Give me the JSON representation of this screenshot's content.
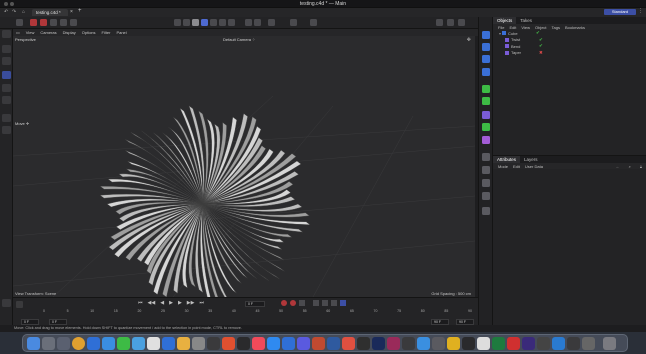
{
  "window": {
    "title": "testing.c4d * — Main"
  },
  "tabs": [
    {
      "label": "testing.c4d *"
    }
  ],
  "layout_label": "Standard",
  "viewport": {
    "menus": [
      "View",
      "Cameras",
      "Display",
      "Options",
      "Filter",
      "Panel"
    ],
    "view_name": "Perspective",
    "camera_name": "Default Camera ⁘",
    "tool_label": "Move ✛",
    "transform_mode": "View Transform: Scene",
    "grid_spacing": "Grid Spacing : 500 cm"
  },
  "object_manager": {
    "tabs": [
      "Objects",
      "Takes"
    ],
    "menu": [
      "File",
      "Edit",
      "View",
      "Object",
      "Tags",
      "Bookmarks"
    ],
    "objects": [
      {
        "name": "Cube",
        "status": "check"
      },
      {
        "name": "Twist",
        "status": "check"
      },
      {
        "name": "Bend",
        "status": "check"
      },
      {
        "name": "Taper",
        "status": "x"
      }
    ]
  },
  "attributes": {
    "tabs": [
      "Attributes",
      "Layers"
    ],
    "menu": [
      "Mode",
      "Edit",
      "User Data"
    ]
  },
  "timeline": {
    "current_frame": "0 F",
    "start_field": "0 F",
    "start_field2": "0 F",
    "end_field": "90 F",
    "end_field2": "90 F",
    "ticks": [
      "0",
      "5",
      "10",
      "15",
      "20",
      "25",
      "30",
      "35",
      "40",
      "45",
      "50",
      "55",
      "60",
      "65",
      "70",
      "75",
      "80",
      "85",
      "90"
    ]
  },
  "statusbar": {
    "text": "Move: Click and drag to move elements. Hold down SHIFT to quantize movement / add to the selection in point mode, CTRL to remove."
  },
  "colors": {
    "accent": "#3c4fa5",
    "check": "#47c34a",
    "error": "#e04a4a"
  }
}
